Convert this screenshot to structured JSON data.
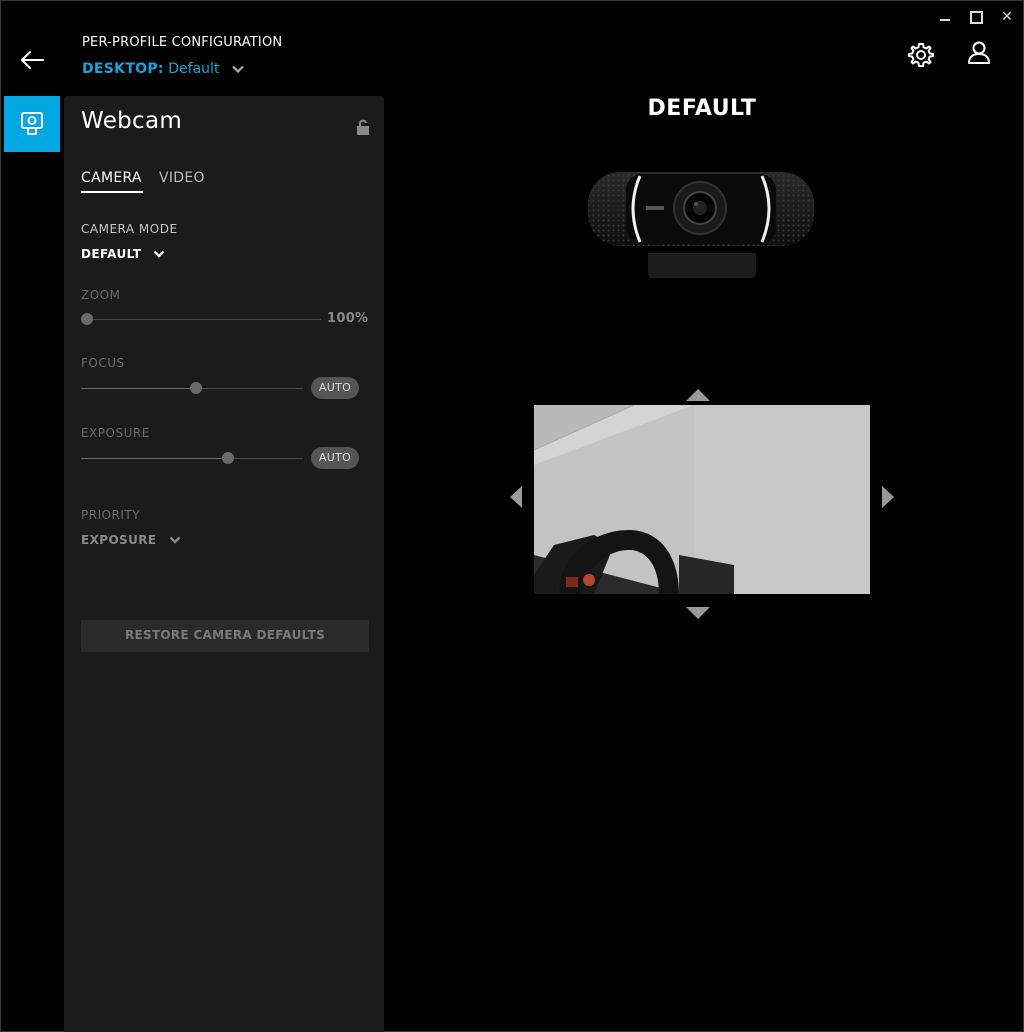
{
  "window": {
    "controls": {
      "minimize": "minimize",
      "maximize": "maximize",
      "close": "✕"
    }
  },
  "header": {
    "config_title": "PER-PROFILE CONFIGURATION",
    "profile_prefix": "DESKTOP:",
    "profile_name": "Default",
    "icons": {
      "back": "back-arrow-icon",
      "settings": "gear-icon",
      "account": "user-icon"
    }
  },
  "device_strip": {
    "selected_icon": "webcam-icon",
    "accent": "#00a7e0"
  },
  "panel": {
    "title": "Webcam",
    "lock_icon": "unlocked-padlock-icon",
    "tabs": [
      {
        "label": "CAMERA",
        "active": true
      },
      {
        "label": "VIDEO",
        "active": false
      }
    ],
    "camera_mode": {
      "label": "CAMERA MODE",
      "value": "DEFAULT"
    },
    "zoom": {
      "label": "ZOOM",
      "value_text": "100%",
      "level": 0.0
    },
    "focus": {
      "label": "FOCUS",
      "auto_label": "AUTO",
      "level": 0.52
    },
    "exposure": {
      "label": "EXPOSURE",
      "auto_label": "AUTO",
      "level": 0.66
    },
    "priority": {
      "label": "PRIORITY",
      "value": "EXPOSURE"
    },
    "restore_button": "RESTORE CAMERA DEFAULTS"
  },
  "main": {
    "title": "DEFAULT",
    "webcam_image": "webcam-product-image",
    "preview": "live-camera-preview"
  },
  "colors": {
    "accent": "#1aa3d9",
    "panel_bg": "#1b1b1b",
    "background": "#000000"
  }
}
